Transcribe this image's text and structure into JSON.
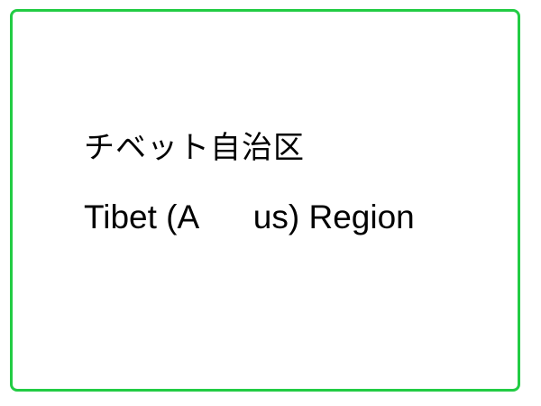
{
  "label": {
    "japanese": "チベット自治区",
    "english": "Tibet (A      us) Region"
  },
  "colors": {
    "border": "#22cc44",
    "text": "#000000",
    "background": "#ffffff"
  }
}
